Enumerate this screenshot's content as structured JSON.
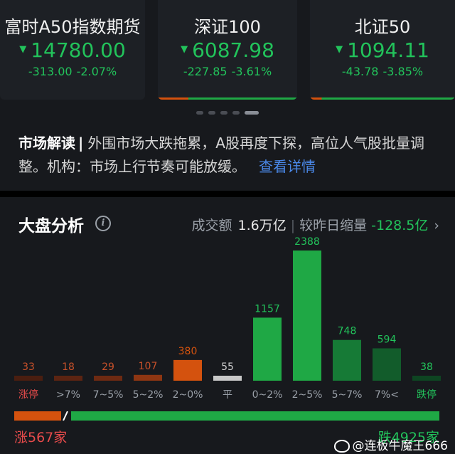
{
  "indices": [
    {
      "name": "富时A50指数期货",
      "price": "14780.00",
      "change": "-313.00",
      "pct": "-2.07%"
    },
    {
      "name": "深证100",
      "price": "6087.98",
      "change": "-227.85",
      "pct": "-3.61%"
    },
    {
      "name": "北证50",
      "price": "1094.11",
      "change": "-43.78",
      "pct": "-3.85%"
    }
  ],
  "carousel": {
    "total": 5,
    "active": 4
  },
  "news": {
    "tag": "市场解读",
    "separator": "|",
    "text": "外围市场大跌拖累，A股再度下探，高位人气股批量调整。机构：市场上行节奏可能放缓。",
    "link": "查看详情"
  },
  "analysis": {
    "title": "大盘分析",
    "info_icon": "info-icon",
    "turnover_label": "成交额",
    "turnover_value": "1.6万亿",
    "compare_label": "较昨日缩量",
    "compare_value": "-128.5亿",
    "chevron": "›"
  },
  "chart_data": {
    "type": "bar",
    "categories": [
      "涨停",
      ">7%",
      "7~5%",
      "5~2%",
      "2~0%",
      "平",
      "0~2%",
      "2~5%",
      "5~7%",
      "7%<",
      "跌停"
    ],
    "values": [
      33,
      18,
      29,
      107,
      380,
      55,
      1157,
      2388,
      748,
      594,
      38
    ],
    "colors": [
      "#4a1e10",
      "#5c2412",
      "#6e2a12",
      "#8e3612",
      "#d4520e",
      "#c8c8c8",
      "#1fa845",
      "#1fa845",
      "#167a36",
      "#125c2b",
      "#0e4522"
    ],
    "label_colors": [
      "#c8512a",
      "#c8512a",
      "#c8512a",
      "#c8512a",
      "#d4520e",
      "#cfcfcf",
      "#22c35b",
      "#22c35b",
      "#22c35b",
      "#22c35b",
      "#22c35b"
    ],
    "tick_colors": [
      "#e84b4b",
      "#9aa0a8",
      "#9aa0a8",
      "#9aa0a8",
      "#9aa0a8",
      "#9aa0a8",
      "#9aa0a8",
      "#9aa0a8",
      "#9aa0a8",
      "#9aa0a8",
      "#22c35b"
    ]
  },
  "ratio": {
    "up_text": "涨567家",
    "down_text": "跌4925家",
    "up": 567,
    "down": 4925
  },
  "watermark": "@连板牛魔王666",
  "colors": {
    "up": "#e84b4b",
    "down": "#22c35b",
    "link": "#4a88e8",
    "background": "#17191d"
  }
}
